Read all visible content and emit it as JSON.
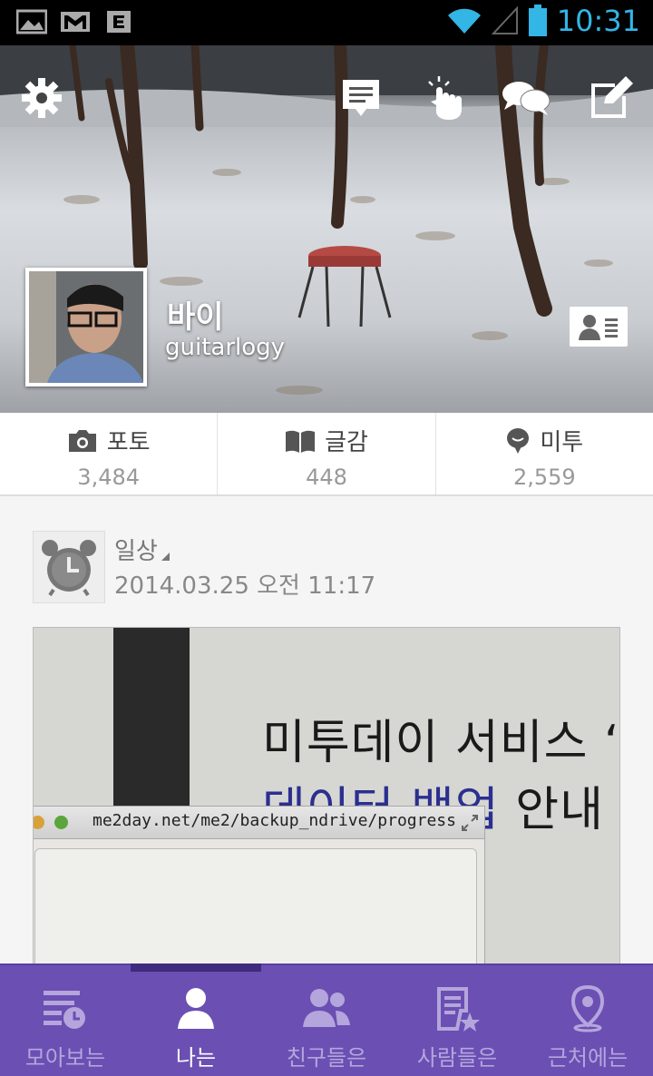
{
  "status_bar": {
    "time": "10:31",
    "icons": [
      "gallery-icon",
      "gmail-icon",
      "e-icon",
      "wifi-icon",
      "signal-icon",
      "battery-icon"
    ]
  },
  "cover": {
    "actions": [
      "settings-icon",
      "message-icon",
      "tap-icon",
      "chat-icon",
      "compose-icon"
    ],
    "profile": {
      "name": "바이",
      "id": "guitarlogy"
    }
  },
  "stats": [
    {
      "label": "포토",
      "value": "3,484",
      "icon": "camera-icon"
    },
    {
      "label": "글감",
      "value": "448",
      "icon": "book-icon"
    },
    {
      "label": "미투",
      "value": "2,559",
      "icon": "speech-bubble-icon"
    }
  ],
  "post": {
    "category": "일상",
    "datetime": "2014.03.25 오전 11:17",
    "image": {
      "line1": "미투데이 서비스 ‘",
      "line2_blue": "데이터 백업",
      "line2_rest": " 안내",
      "url": "me2day.net/me2/backup_ndrive/progress"
    }
  },
  "bottom_nav": {
    "items": [
      {
        "label": "모아보는",
        "icon": "timeline-icon"
      },
      {
        "label": "나는",
        "icon": "person-icon"
      },
      {
        "label": "친구들은",
        "icon": "friends-icon"
      },
      {
        "label": "사람들은",
        "icon": "starred-doc-icon"
      },
      {
        "label": "근처에는",
        "icon": "location-pin-icon"
      }
    ],
    "active_index": 1
  },
  "colors": {
    "nav_bg": "#6b4fb3",
    "clock": "#33b5e5"
  }
}
